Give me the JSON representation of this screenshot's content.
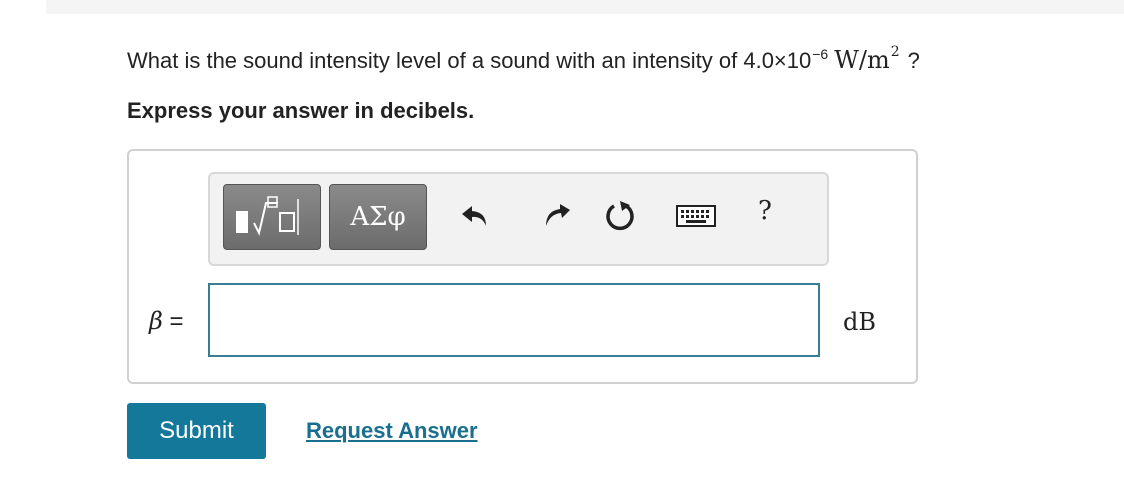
{
  "question": {
    "prefix": "What is the sound intensity level of a sound with an intensity of 4.0×10",
    "exponent": "−6",
    "unit": "W/m",
    "unit_exponent": "2",
    "suffix": "?"
  },
  "instruction": "Express your answer in decibels.",
  "toolbar": {
    "symbols_label": "ΑΣφ",
    "help_label": "?",
    "icons": [
      "templates-icon",
      "greek-symbols-icon",
      "undo-icon",
      "redo-icon",
      "reset-icon",
      "keyboard-icon",
      "help-icon"
    ]
  },
  "answer": {
    "variable": "β",
    "equals": "=",
    "value": "",
    "unit": "dB"
  },
  "actions": {
    "submit_label": "Submit",
    "request_label": "Request Answer"
  },
  "colors": {
    "submit_bg": "#13789a",
    "link": "#1a6f91",
    "input_border": "#3a7c93",
    "toolbar_button": "#7a7a7a"
  }
}
